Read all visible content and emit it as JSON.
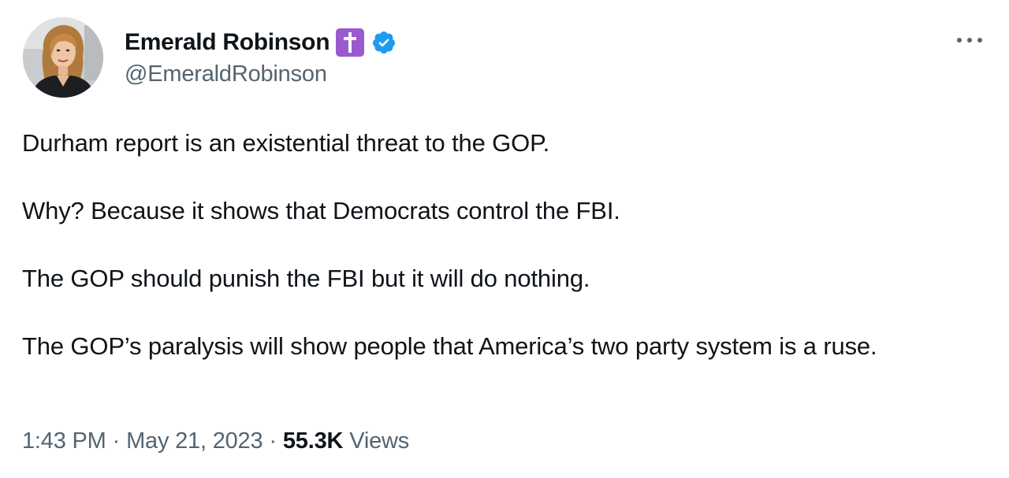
{
  "author": {
    "display_name": "Emerald Robinson",
    "handle": "@EmeraldRobinson",
    "badges": {
      "cross_icon": "latin-cross-icon",
      "cross_color": "#9b59d0",
      "verified_icon": "verified-check-icon",
      "verified_color": "#1d9bf0"
    }
  },
  "tweet": {
    "paragraphs": [
      "Durham report is an existential threat to the GOP.",
      "Why? Because it shows that Democrats control the FBI.",
      "The GOP should punish the FBI but it will do nothing.",
      "The GOP’s paralysis will show people that America’s two party system is a ruse."
    ]
  },
  "meta": {
    "time": "1:43 PM",
    "separator": "·",
    "date": "May 21, 2023",
    "views_count": "55.3K",
    "views_label": "Views"
  },
  "menu": {
    "more_icon": "more-horizontal-icon"
  },
  "colors": {
    "text_primary": "#0f1419",
    "text_secondary": "#536471"
  }
}
